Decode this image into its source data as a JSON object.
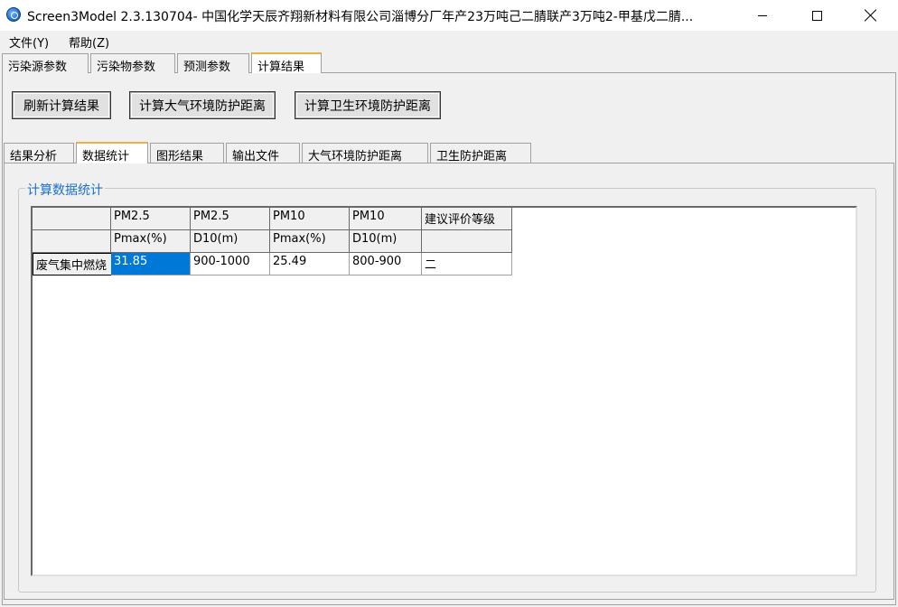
{
  "window": {
    "title": "Screen3Model 2.3.130704- 中国化学天辰齐翔新材料有限公司淄博分厂年产23万吨己二腈联产3万吨2-甲基戊二腈..."
  },
  "menu": [
    "文件(Y)",
    "帮助(Z)"
  ],
  "main_tabs": [
    "污染源参数",
    "污染物参数",
    "预测参数",
    "计算结果"
  ],
  "buttons": {
    "refresh": "刷新计算结果",
    "air_distance": "计算大气环境防护距离",
    "health_distance": "计算卫生环境防护距离"
  },
  "sub_tabs": [
    "结果分析",
    "数据统计",
    "图形结果",
    "输出文件",
    "大气环境防护距离",
    "卫生防护距离"
  ],
  "group": {
    "title": "计算数据统计"
  },
  "table": {
    "header_row1": [
      "PM2.5",
      "PM2.5",
      "PM10",
      "PM10",
      "建议评价等级"
    ],
    "header_row2": [
      "Pmax(%)",
      "D10(m)",
      "Pmax(%)",
      "D10(m)",
      ""
    ],
    "rows": [
      {
        "label": "废气集中燃烧",
        "values": [
          "31.85",
          "900-1000",
          "25.49",
          "800-900",
          "二"
        ]
      }
    ]
  },
  "colors": {
    "accent": "#0078d7",
    "legend": "#1a6fd0",
    "tab_highlight": "#f0b040"
  }
}
